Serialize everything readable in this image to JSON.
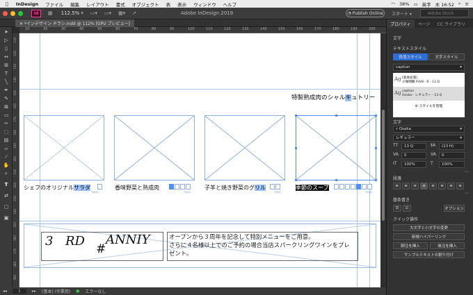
{
  "menubar": {
    "app": "InDesign",
    "items": [
      "ファイル",
      "編集",
      "レイアウト",
      "書式",
      "オブジェクト",
      "表",
      "表示",
      "ウィンドウ",
      "ヘルプ"
    ],
    "battery": "38%",
    "input": "英字",
    "clock": "木 16:52"
  },
  "appbar": {
    "window_title": "Adobe InDesign 2019",
    "zoom": "112.5%",
    "publish": "Publish Online",
    "workspace": "スタート",
    "search_placeholder": "Adobe Stock"
  },
  "doctab": {
    "label": "*インデザイン チラシ.indd @ 112% [GPU プレビュー]"
  },
  "ruler": {
    "ticks": [
      "10",
      "20",
      "30",
      "40",
      "50",
      "60",
      "70",
      "80",
      "90",
      "100",
      "110",
      "120",
      "130",
      "140",
      "150",
      "160",
      "170",
      "180",
      "190",
      "200"
    ]
  },
  "vruler": {
    "ticks": [
      "110",
      "120",
      "130",
      "140",
      "150",
      "160",
      "170",
      "180",
      "190",
      "200",
      "210",
      "220",
      "230",
      "240",
      "250",
      "260",
      "270",
      "280",
      "290"
    ]
  },
  "page": {
    "headline": {
      "before": "特製熟成肉のシャル",
      "hl": "キ",
      "after": "ュトリー"
    },
    "captions": [
      {
        "before": "シェフのオリジナル",
        "hl": "サラダ",
        "after": ""
      },
      {
        "before": "香味野菜と熟成肉",
        "hl": "",
        "after": ""
      },
      {
        "before": "子羊と焼き野菜のグ",
        "hl": "リル",
        "after": ""
      },
      {
        "before": "",
        "sel": "季節のスープ",
        "after": ""
      }
    ],
    "anniv": {
      "t1": "3",
      "t2": "RD",
      "t3": "#",
      "t4": "ANNIY"
    },
    "body_lines": [
      "オープンから３周年を記念して特別メニューをご用意。",
      "さらに４名様以上でのご予約の場合当店スパークリングワインをプレ",
      "ゼント。"
    ]
  },
  "status": {
    "page": "1",
    "master": "[基本] (作業用)",
    "preflight": "エラーなし"
  },
  "panel": {
    "tabs": [
      "プロパティ",
      "ページ",
      "CC ライブラリ"
    ],
    "section_char": "文字",
    "text_style": "テキストスタイル",
    "para_style_btn": "段落スタイル",
    "char_style_btn": "文字スタイル",
    "current_style": "caption",
    "styles": [
      {
        "name": "[基本段落]",
        "detail": "小塚明朝 Pr6N - R - 13 Q"
      },
      {
        "name": "caption",
        "detail": "Osaka - レギュラー - 13 Q"
      }
    ],
    "manage_styles": "スタイルを管理",
    "char_label": "文字",
    "font": "Osaka",
    "font_style": "レギュラー",
    "size": "13 Q",
    "leading": "(13 H)",
    "tracking": "0",
    "kerning": "0",
    "scale_v": "100%",
    "scale_h": "100%",
    "para_label": "段落",
    "bullets_label": "箇条書き",
    "options_btn": "オプション",
    "quick_label": "クイック操作",
    "quick_actions": [
      "大文字と小文字の変更",
      "新規ハイパーリンク",
      "脚注を挿入",
      "後注を挿入",
      "サンプルテキストの割り付け"
    ]
  }
}
